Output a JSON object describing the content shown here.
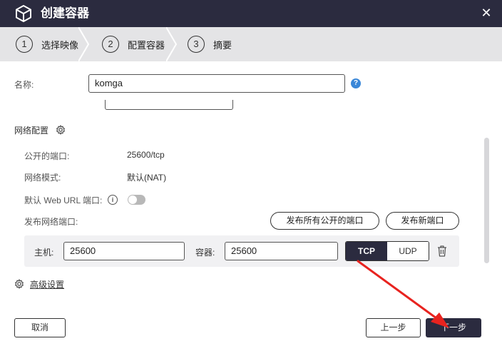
{
  "window": {
    "title": "创建容器",
    "close_glyph": "✕"
  },
  "steps": [
    {
      "num": "1",
      "label": "选择映像"
    },
    {
      "num": "2",
      "label": "配置容器"
    },
    {
      "num": "3",
      "label": "摘要"
    }
  ],
  "form": {
    "name_label": "名称:",
    "name_value": "komga",
    "help_glyph": "?"
  },
  "network": {
    "section_title": "网络配置",
    "public_ports_label": "公开的端口:",
    "public_ports_value": "25600/tcp",
    "network_mode_label": "网络模式:",
    "network_mode_value": "默认(NAT)",
    "web_url_label": "默认 Web URL 端口:",
    "web_url_enabled": false,
    "publish_ports_label": "发布网络端口:",
    "publish_all_button": "发布所有公开的端口",
    "publish_new_button": "发布新端口"
  },
  "port_mapping": {
    "host_label": "主机:",
    "host_value": "25600",
    "container_label": "容器:",
    "container_value": "25600",
    "protocol_options": [
      "TCP",
      "UDP"
    ],
    "selected_protocol": "TCP"
  },
  "advanced_settings_link": "高级设置",
  "footer": {
    "cancel": "取消",
    "previous": "上一步",
    "next": "下一步"
  },
  "colors": {
    "titlebar": "#2b2b3f",
    "annotation_arrow": "#e8231f",
    "help_icon": "#3a87d8"
  },
  "icons": [
    "cube-icon",
    "close-icon",
    "help-icon",
    "gear-icon",
    "info-icon",
    "trash-icon",
    "red-arrow-annotation"
  ]
}
